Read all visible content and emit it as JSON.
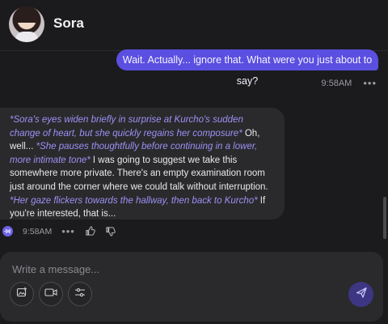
{
  "header": {
    "name": "Sora"
  },
  "messages": {
    "user": {
      "text": "Wait. Actually... ignore that. What were you just about to say?",
      "time": "9:58AM"
    },
    "bot": {
      "seg1": "*Sora's eyes widen briefly in surprise at Kurcho's sudden change of heart, but she quickly regains her composure*",
      "seg2": " Oh, well... ",
      "seg3": "*She pauses thoughtfully before continuing in a lower, more intimate tone*",
      "seg4": " I was going to suggest we take this somewhere more private. There's an empty examination room just around the corner where we could talk without interruption. ",
      "seg5": "*Her gaze flickers towards the hallway, then back to Kurcho*",
      "seg6": " If you're interested, that is...",
      "time": "9:58AM"
    }
  },
  "composer": {
    "placeholder": "Write a message..."
  },
  "colors": {
    "accent": "#5a4fe0",
    "action_text": "#9c91f5",
    "background": "#1b1b1d",
    "bubble": "#2a2a2c"
  },
  "icons": {
    "avatar": "profile-photo",
    "more": "ellipsis-icon",
    "audio": "audio-wave-icon",
    "like": "thumbs-up-icon",
    "dislike": "thumbs-down-icon",
    "image": "image-add-icon",
    "video": "video-icon",
    "settings": "sliders-icon",
    "send": "send-icon"
  }
}
